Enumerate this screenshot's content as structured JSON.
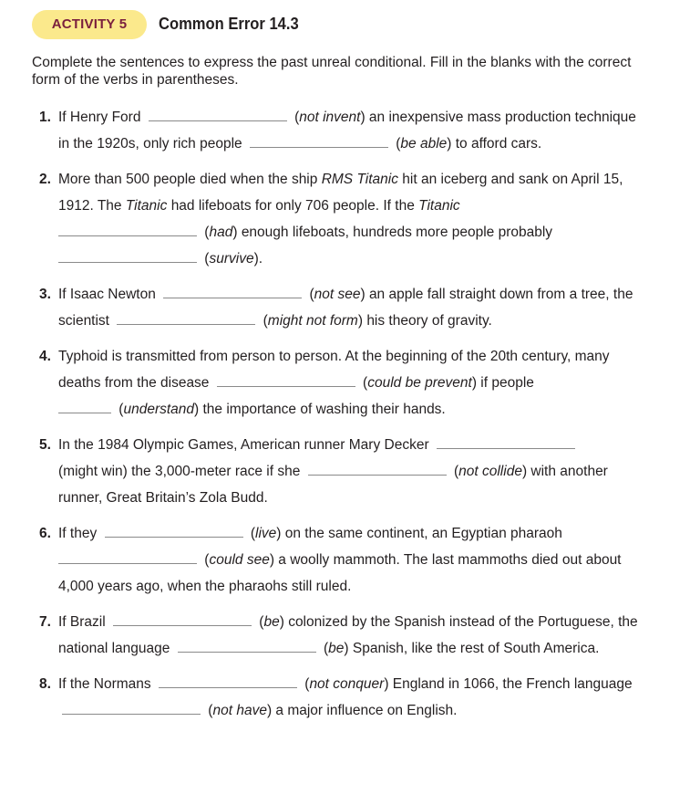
{
  "header": {
    "badge": "ACTIVITY 5",
    "title": "Common Error 14.3"
  },
  "instructions": "Complete the sentences to express the past unreal conditional. Fill in the blanks with the correct form of the verbs in parentheses.",
  "items": [
    {
      "num": "1.",
      "t1": "If Henry Ford",
      "v1": "not invent",
      "t2": "an inexpensive mass production technique in the 1920s, only rich people",
      "v2": "be able",
      "t3": "to afford cars."
    },
    {
      "num": "2.",
      "t1": "More than 500 people died when the ship",
      "ship": "RMS Titanic",
      "t2": "hit an iceberg and sank on April 15, 1912. The",
      "ship2": "Titanic",
      "t3": "had lifeboats for only 706 people. If the",
      "ship3": "Titanic",
      "v1": "had",
      "t4": "enough lifeboats, hundreds more people probably",
      "v2": "survive"
    },
    {
      "num": "3.",
      "t1": "If Isaac Newton",
      "v1": "not see",
      "t2": "an apple fall straight down from a tree, the scientist",
      "v2": "might not form",
      "t3": "his theory of gravity."
    },
    {
      "num": "4.",
      "t1": "Typhoid is transmitted from person to person. At the beginning of the 20th century, many deaths from the disease",
      "v1": "could be prevent",
      "t2": "if people",
      "v2": "understand",
      "t3": "the importance of washing their hands."
    },
    {
      "num": "5.",
      "t1": "In the 1984 Olympic Games, American runner Mary Decker",
      "v1": "might win",
      "t2": "the 3,000-meter race if she",
      "v2": "not collide",
      "t3": "with another runner, Great Britain’s Zola Budd."
    },
    {
      "num": "6.",
      "t1": "If they",
      "v1": "live",
      "t2": "on the same continent, an Egyptian pharaoh",
      "v2": "could see",
      "t3": "a woolly mammoth. The last mammoths died out about 4,000 years ago, when the pharaohs still ruled."
    },
    {
      "num": "7.",
      "t1": "If Brazil",
      "v1": "be",
      "t2": "colonized by the Spanish instead of the Portuguese, the national language",
      "v2": "be",
      "t3": "Spanish, like the rest of South America."
    },
    {
      "num": "8.",
      "t1": "If the Normans",
      "v1": "not conquer",
      "t2": "England in 1066, the French language",
      "v2": "not have",
      "t3": "a major influence on English."
    }
  ]
}
